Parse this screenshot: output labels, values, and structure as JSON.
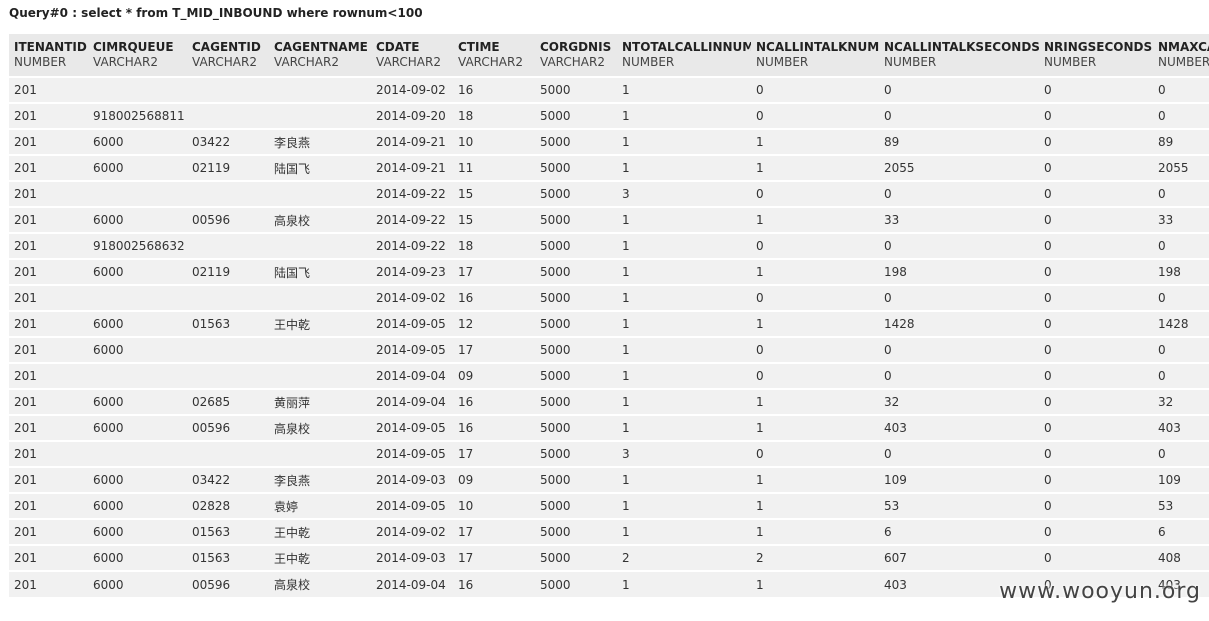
{
  "query": {
    "title": "Query#0 : select * from T_MID_INBOUND where rownum<100"
  },
  "columns": [
    {
      "name": "ITENANTID",
      "type": "NUMBER"
    },
    {
      "name": "CIMRQUEUE",
      "type": "VARCHAR2"
    },
    {
      "name": "CAGENTID",
      "type": "VARCHAR2"
    },
    {
      "name": "CAGENTNAME",
      "type": "VARCHAR2"
    },
    {
      "name": "CDATE",
      "type": "VARCHAR2"
    },
    {
      "name": "CTIME",
      "type": "VARCHAR2"
    },
    {
      "name": "CORGDNIS",
      "type": "VARCHAR2"
    },
    {
      "name": "NTOTALCALLINNUM",
      "type": "NUMBER"
    },
    {
      "name": "NCALLINTALKNUM",
      "type": "NUMBER"
    },
    {
      "name": "NCALLINTALKSECONDS",
      "type": "NUMBER"
    },
    {
      "name": "NRINGSECONDS",
      "type": "NUMBER"
    },
    {
      "name": "NMAXCA",
      "type": "NUMBER"
    }
  ],
  "rows": [
    [
      "201",
      "",
      "",
      "",
      "2014-09-02",
      "16",
      "5000",
      "1",
      "0",
      "0",
      "0",
      "0"
    ],
    [
      "201",
      "918002568811",
      "",
      "",
      "2014-09-20",
      "18",
      "5000",
      "1",
      "0",
      "0",
      "0",
      "0"
    ],
    [
      "201",
      "6000",
      "03422",
      "李良燕",
      "2014-09-21",
      "10",
      "5000",
      "1",
      "1",
      "89",
      "0",
      "89"
    ],
    [
      "201",
      "6000",
      "02119",
      "陆国飞",
      "2014-09-21",
      "11",
      "5000",
      "1",
      "1",
      "2055",
      "0",
      "2055"
    ],
    [
      "201",
      "",
      "",
      "",
      "2014-09-22",
      "15",
      "5000",
      "3",
      "0",
      "0",
      "0",
      "0"
    ],
    [
      "201",
      "6000",
      "00596",
      "高泉校",
      "2014-09-22",
      "15",
      "5000",
      "1",
      "1",
      "33",
      "0",
      "33"
    ],
    [
      "201",
      "918002568632",
      "",
      "",
      "2014-09-22",
      "18",
      "5000",
      "1",
      "0",
      "0",
      "0",
      "0"
    ],
    [
      "201",
      "6000",
      "02119",
      "陆国飞",
      "2014-09-23",
      "17",
      "5000",
      "1",
      "1",
      "198",
      "0",
      "198"
    ],
    [
      "201",
      "",
      "",
      "",
      "2014-09-02",
      "16",
      "5000",
      "1",
      "0",
      "0",
      "0",
      "0"
    ],
    [
      "201",
      "6000",
      "01563",
      "王中乾",
      "2014-09-05",
      "12",
      "5000",
      "1",
      "1",
      "1428",
      "0",
      "1428"
    ],
    [
      "201",
      "6000",
      "",
      "",
      "2014-09-05",
      "17",
      "5000",
      "1",
      "0",
      "0",
      "0",
      "0"
    ],
    [
      "201",
      "",
      "",
      "",
      "2014-09-04",
      "09",
      "5000",
      "1",
      "0",
      "0",
      "0",
      "0"
    ],
    [
      "201",
      "6000",
      "02685",
      "黄丽萍",
      "2014-09-04",
      "16",
      "5000",
      "1",
      "1",
      "32",
      "0",
      "32"
    ],
    [
      "201",
      "6000",
      "00596",
      "高泉校",
      "2014-09-05",
      "16",
      "5000",
      "1",
      "1",
      "403",
      "0",
      "403"
    ],
    [
      "201",
      "",
      "",
      "",
      "2014-09-05",
      "17",
      "5000",
      "3",
      "0",
      "0",
      "0",
      "0"
    ],
    [
      "201",
      "6000",
      "03422",
      "李良燕",
      "2014-09-03",
      "09",
      "5000",
      "1",
      "1",
      "109",
      "0",
      "109"
    ],
    [
      "201",
      "6000",
      "02828",
      "袁婷",
      "2014-09-05",
      "10",
      "5000",
      "1",
      "1",
      "53",
      "0",
      "53"
    ],
    [
      "201",
      "6000",
      "01563",
      "王中乾",
      "2014-09-02",
      "17",
      "5000",
      "1",
      "1",
      "6",
      "0",
      "6"
    ],
    [
      "201",
      "6000",
      "01563",
      "王中乾",
      "2014-09-03",
      "17",
      "5000",
      "2",
      "2",
      "607",
      "0",
      "408"
    ],
    [
      "201",
      "6000",
      "00596",
      "高泉校",
      "2014-09-04",
      "16",
      "5000",
      "1",
      "1",
      "403",
      "0",
      "403"
    ]
  ],
  "watermark": {
    "text": "www.wooyun.org"
  }
}
